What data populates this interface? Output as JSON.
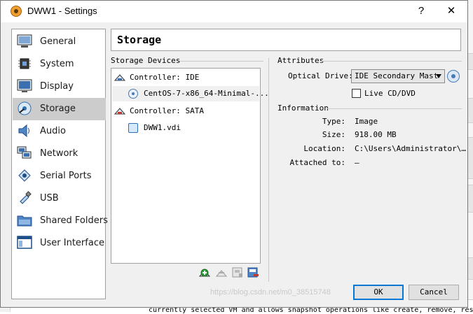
{
  "window": {
    "title": "DWW1 - Settings",
    "help_glyph": "?",
    "close_glyph": "✕"
  },
  "sidebar": {
    "items": [
      {
        "label": "General",
        "icon": "monitor-icon"
      },
      {
        "label": "System",
        "icon": "chip-icon"
      },
      {
        "label": "Display",
        "icon": "display-icon"
      },
      {
        "label": "Storage",
        "icon": "storage-icon",
        "active": true
      },
      {
        "label": "Audio",
        "icon": "speaker-icon"
      },
      {
        "label": "Network",
        "icon": "network-icon"
      },
      {
        "label": "Serial Ports",
        "icon": "serial-port-icon"
      },
      {
        "label": "USB",
        "icon": "usb-icon"
      },
      {
        "label": "Shared Folders",
        "icon": "folder-icon"
      },
      {
        "label": "User Interface",
        "icon": "ui-window-icon"
      }
    ]
  },
  "header": {
    "title": "Storage"
  },
  "storage": {
    "devices_label": "Storage Devices",
    "controllers": [
      {
        "name": "Controller: IDE",
        "attachments": [
          {
            "name": "CentOS-7-x86_64-Minimal-...",
            "type": "optical"
          }
        ]
      },
      {
        "name": "Controller: SATA",
        "attachments": [
          {
            "name": "DWW1.vdi",
            "type": "hdd"
          }
        ]
      }
    ]
  },
  "attributes": {
    "label": "Attributes",
    "optical_drive_label": "Optical Drive:",
    "optical_drive_value": "IDE Secondary Mast",
    "live_cd_label": "Live CD/DVD",
    "live_cd_checked": false
  },
  "information": {
    "label": "Information",
    "type_label": "Type:",
    "type_value": "Image",
    "size_label": "Size:",
    "size_value": "918.00  MB",
    "location_label": "Location:",
    "location_value": "C:\\Users\\Administrator\\…",
    "attached_label": "Attached to:",
    "attached_value": "—"
  },
  "buttons": {
    "ok": "OK",
    "cancel": "Cancel"
  },
  "background": {
    "bottom_text": "currently selected VM and allows snapshot operations like create, remove, res",
    "watermark": "https://blog.csdn.net/m0_38515748"
  }
}
